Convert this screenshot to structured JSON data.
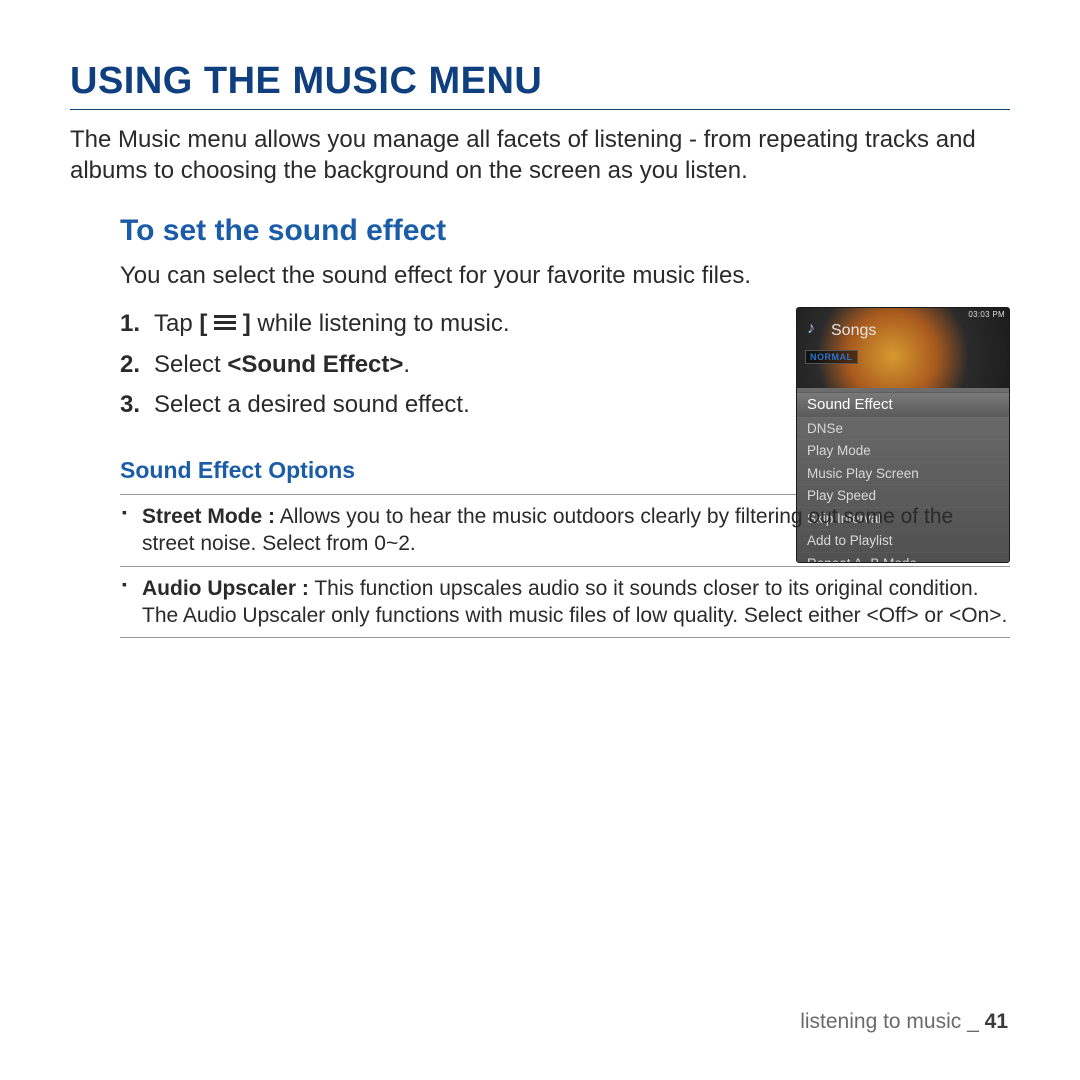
{
  "title": "USING THE MUSIC MENU",
  "intro": "The Music menu allows you manage all facets of listening - from repeating tracks and albums to choosing the background on the screen as you listen.",
  "section": {
    "heading": "To set the sound effect",
    "lead": "You can select the sound effect for your favorite music files.",
    "steps": {
      "s1a": "Tap ",
      "s1b": "[ ",
      "s1c": " ]",
      "s1d": " while listening to music.",
      "s2a": "Select ",
      "s2b": "<Sound Effect>",
      "s2c": ".",
      "s3": "Select a desired sound effect."
    }
  },
  "device": {
    "status": "03:03 PM",
    "songs_label": "Songs",
    "badge": "NORMAL",
    "menu": [
      "Sound Effect",
      "DNSe",
      "Play Mode",
      "Music Play Screen",
      "Play Speed",
      "Skip Interval",
      "Add to Playlist",
      "Repeat A~B Mode"
    ]
  },
  "options": {
    "heading": "Sound Effect Options",
    "items": [
      {
        "name": "Street Mode :",
        "desc": " Allows you to hear the music outdoors clearly by filtering out some of the street noise. Select from 0~2."
      },
      {
        "name": "Audio Upscaler :",
        "desc": " This function upscales audio so it sounds closer to its original condition. The Audio Upscaler only functions with music files of low quality. Select either <Off> or <On>."
      }
    ]
  },
  "footer": {
    "section": "listening to music",
    "sep": " _ ",
    "page": "41"
  }
}
